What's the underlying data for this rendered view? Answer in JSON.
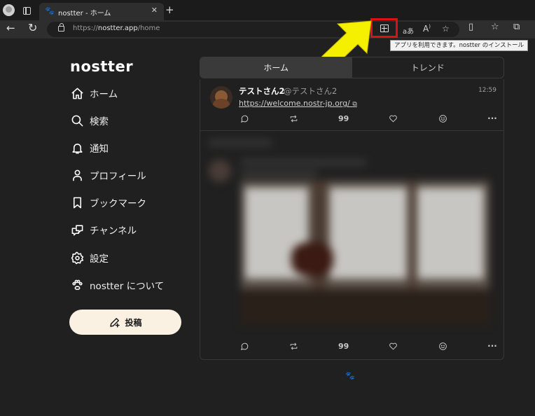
{
  "browser": {
    "tab_title": "nostter - ホーム",
    "tab_close": "✕",
    "new_tab": "+",
    "url_scheme": "https://",
    "url_host": "nostter.app",
    "url_path": "/home",
    "omnibox_icons": [
      "install-app-icon",
      "translate-icon",
      "read-aloud-icon",
      "favorite-icon"
    ],
    "translate_glyph": "aあ",
    "read_aloud_glyph": "A",
    "tooltip": "アプリを利用できます。nostter のインストール",
    "highlight_color": "#e01010",
    "arrow_color": "#f4f000"
  },
  "sidebar": {
    "logo": "nostter",
    "items": [
      {
        "label": "ホーム",
        "icon": "home-icon"
      },
      {
        "label": "検索",
        "icon": "search-icon"
      },
      {
        "label": "通知",
        "icon": "bell-icon"
      },
      {
        "label": "プロフィール",
        "icon": "user-icon"
      },
      {
        "label": "ブックマーク",
        "icon": "bookmark-icon"
      },
      {
        "label": "チャンネル",
        "icon": "chat-icon"
      },
      {
        "label": "設定",
        "icon": "gear-icon"
      },
      {
        "label": "nostter について",
        "icon": "paw-icon"
      }
    ],
    "post_button": "投稿",
    "accent_color": "#fbf1e3"
  },
  "main": {
    "tabs": [
      {
        "label": "ホーム",
        "active": true
      },
      {
        "label": "トレンド",
        "active": false
      }
    ],
    "notes": [
      {
        "author": "テストさん2",
        "handle": "@テストさん2",
        "time": "12:59",
        "link": "https://welcome.nostr-jp.org/"
      }
    ],
    "quote_glyph": "99",
    "more_glyph": "···"
  }
}
